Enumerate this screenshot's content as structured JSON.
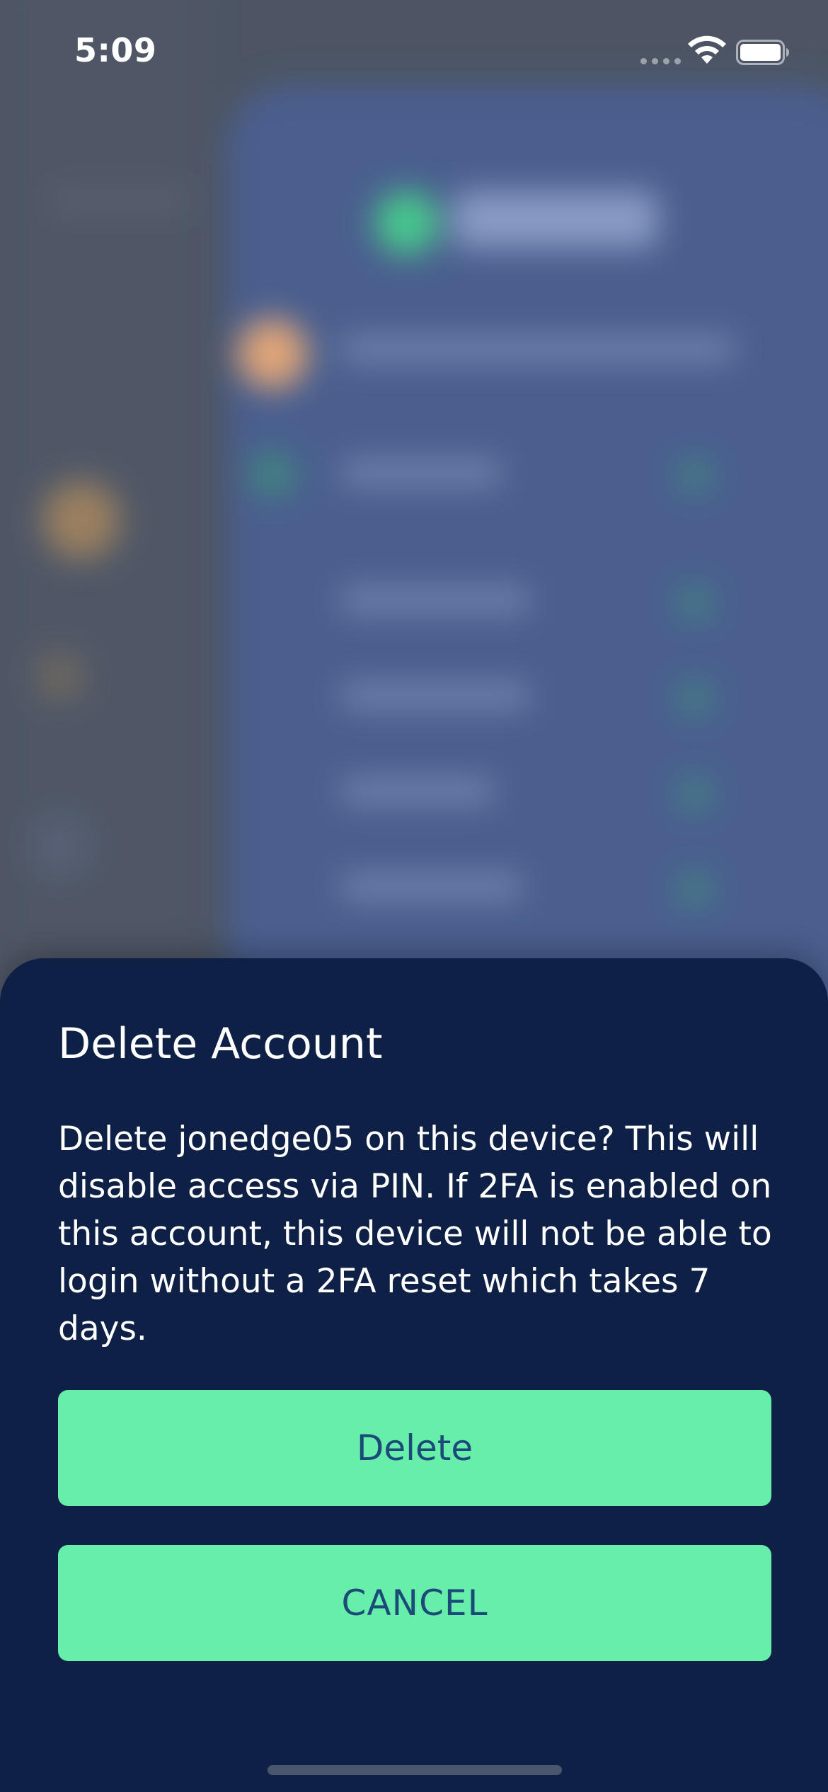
{
  "status_bar": {
    "time": "5:09",
    "icons": [
      "cellular-signal-icon",
      "wifi-icon",
      "battery-icon"
    ]
  },
  "modal": {
    "title": "Delete Account",
    "message": "Delete jonedge05 on this device? This will disable access via PIN. If 2FA is enabled on this account, this device will not be able to login without a 2FA reset which takes 7 days.",
    "delete_label": "Delete",
    "cancel_label": "CANCEL"
  },
  "colors": {
    "sheet_background": "#0e2046",
    "button_background": "#66eeaa",
    "button_text": "#1b4a78",
    "text": "#ffffff",
    "backdrop_panel": "#4a5f8e"
  }
}
